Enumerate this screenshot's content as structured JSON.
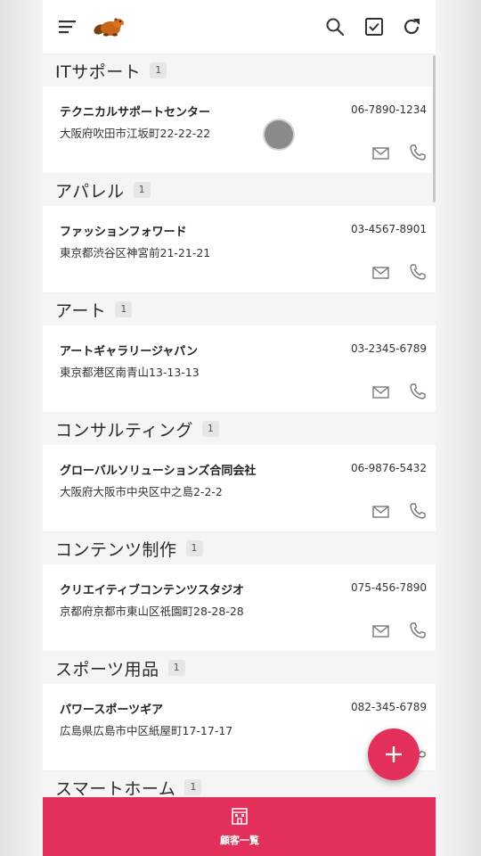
{
  "toolbar": {
    "menu_icon": "hamburger-icon",
    "logo_icon": "beaver-logo",
    "search_icon": "search-icon",
    "select_icon": "checkbox-icon",
    "refresh_icon": "refresh-icon"
  },
  "sections": [
    {
      "title": "ITサポート",
      "count": "1",
      "item": {
        "name": "テクニカルサポートセンター",
        "phone": "06-7890-1234",
        "address": "大阪府吹田市江坂町22-22-22"
      }
    },
    {
      "title": "アパレル",
      "count": "1",
      "item": {
        "name": "ファッションフォワード",
        "phone": "03-4567-8901",
        "address": "東京都渋谷区神宮前21-21-21"
      }
    },
    {
      "title": "アート",
      "count": "1",
      "item": {
        "name": "アートギャラリージャパン",
        "phone": "03-2345-6789",
        "address": "東京都港区南青山13-13-13"
      }
    },
    {
      "title": "コンサルティング",
      "count": "1",
      "item": {
        "name": "グローバルソリューションズ合同会社",
        "phone": "06-9876-5432",
        "address": "大阪府大阪市中央区中之島2-2-2"
      }
    },
    {
      "title": "コンテンツ制作",
      "count": "1",
      "item": {
        "name": "クリエイティブコンテンツスタジオ",
        "phone": "075-456-7890",
        "address": "京都府京都市東山区祇園町28-28-28"
      }
    },
    {
      "title": "スポーツ用品",
      "count": "1",
      "item": {
        "name": "パワースポーツギア",
        "phone": "082-345-6789",
        "address": "広島県広島市中区紙屋町17-17-17"
      }
    },
    {
      "title": "スマートホーム",
      "count": "1"
    }
  ],
  "fab": {
    "icon": "plus-icon"
  },
  "bottom_nav": {
    "label": "顧客一覧",
    "icon": "building-icon"
  },
  "colors": {
    "accent": "#e3305a"
  }
}
